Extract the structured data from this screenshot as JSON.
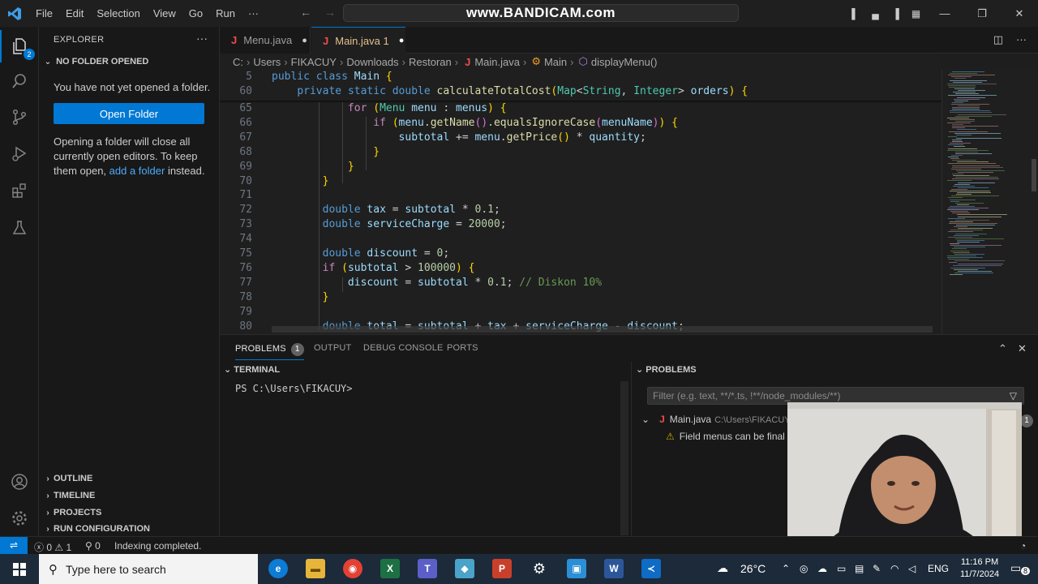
{
  "titlebar": {
    "menu": [
      "File",
      "Edit",
      "Selection",
      "View",
      "Go",
      "Run",
      "···"
    ],
    "watermark": "www.BANDICAM.com"
  },
  "activitybar": {
    "explorer_badge": "2"
  },
  "sidebar": {
    "title": "EXPLORER",
    "section": "NO FOLDER OPENED",
    "message": "You have not yet opened a folder.",
    "open_folder_label": "Open Folder",
    "info_1": "Opening a folder will close all currently open editors. To keep them open, ",
    "info_link": "add a folder",
    "info_2": " instead.",
    "bottom_sections": [
      "OUTLINE",
      "TIMELINE",
      "PROJECTS",
      "RUN CONFIGURATION"
    ]
  },
  "tabs": [
    {
      "label": "Menu.java",
      "modified": true
    },
    {
      "label": "Main.java 1",
      "modified": true,
      "active": true
    }
  ],
  "breadcrumb": {
    "parts": [
      "C:",
      "Users",
      "FIKACUY",
      "Downloads",
      "Restoran"
    ],
    "file": "Main.java",
    "class": "Main",
    "method": "displayMenu()"
  },
  "editor": {
    "sticky": [
      {
        "n": "5",
        "text": "public class Main {"
      },
      {
        "n": "60",
        "text": "    private static double calculateTotalCost(Map<String, Integer> orders) {"
      }
    ],
    "lines": [
      {
        "n": "65",
        "text": "            for (Menu menu : menus) {"
      },
      {
        "n": "66",
        "text": "                if (menu.getName().equalsIgnoreCase(menuName)) {"
      },
      {
        "n": "67",
        "text": "                    subtotal += menu.getPrice() * quantity;"
      },
      {
        "n": "68",
        "text": "                }"
      },
      {
        "n": "69",
        "text": "            }"
      },
      {
        "n": "70",
        "text": "        }"
      },
      {
        "n": "71",
        "text": ""
      },
      {
        "n": "72",
        "text": "        double tax = subtotal * 0.1;"
      },
      {
        "n": "73",
        "text": "        double serviceCharge = 20000;"
      },
      {
        "n": "74",
        "text": ""
      },
      {
        "n": "75",
        "text": "        double discount = 0;"
      },
      {
        "n": "76",
        "text": "        if (subtotal > 100000) {"
      },
      {
        "n": "77",
        "text": "            discount = subtotal * 0.1; // Diskon 10%"
      },
      {
        "n": "78",
        "text": "        }"
      },
      {
        "n": "79",
        "text": ""
      },
      {
        "n": "80",
        "text": "        double total = subtotal + tax + serviceCharge - discount;"
      }
    ]
  },
  "panel": {
    "tabs": [
      "PROBLEMS",
      "OUTPUT",
      "DEBUG CONSOLE",
      "PORTS"
    ],
    "problems_count": "1",
    "terminal_title": "TERMINAL",
    "terminal_prompt": "PS C:\\Users\\FIKACUY>",
    "problems_title": "PROBLEMS",
    "filter_placeholder": "Filter (e.g. text, **/*.ts, !**/node_modules/**)",
    "problem_file": "Main.java",
    "problem_path": "C:\\Users\\FIKACUY",
    "problem_message": "Field menus can be final",
    "problem_file_count": "1"
  },
  "statusbar": {
    "errors": "0",
    "warnings": "1",
    "ports": "0",
    "message": "Indexing completed."
  },
  "taskbar": {
    "search_placeholder": "Type here to search",
    "weather": "26°C",
    "lang": "ENG",
    "time": "11:16 PM",
    "date": "11/7/2024",
    "notifications": "8"
  },
  "colors": {
    "accent": "#0078d4",
    "keyword": "#569cd6",
    "type": "#4ec9b0",
    "function": "#dcdcaa",
    "variable": "#9cdcfe",
    "number": "#b5cea8",
    "comment": "#6a9955"
  }
}
